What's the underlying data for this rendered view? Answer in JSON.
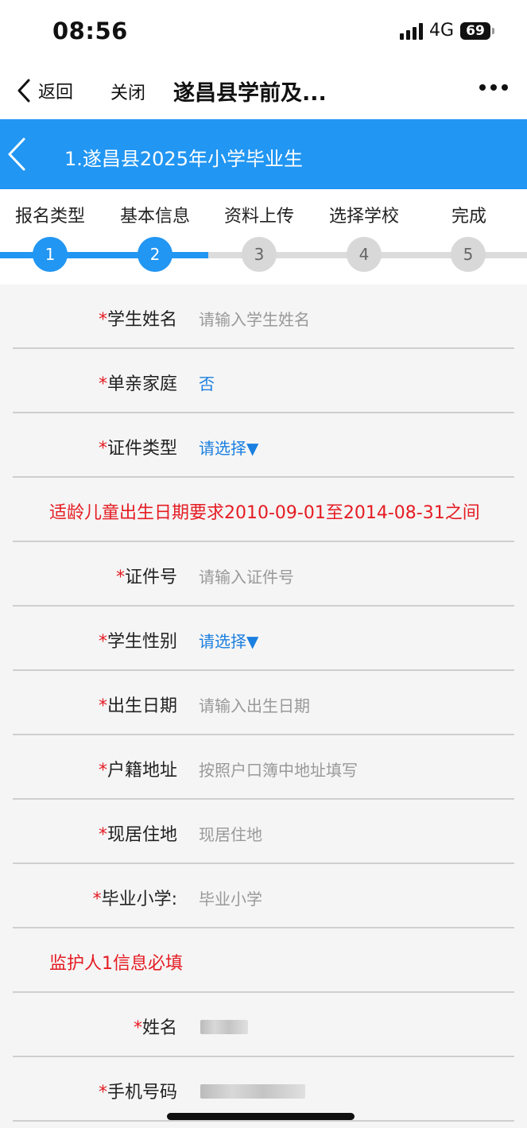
{
  "status": {
    "time": "08:56",
    "network": "4G",
    "battery": "69"
  },
  "nav": {
    "back_label": "返回",
    "close_label": "关闭",
    "title": "遂昌县学前及..."
  },
  "header": {
    "title": "1.遂昌县2025年小学毕业生"
  },
  "steps": [
    {
      "label": "报名类型",
      "number": "1",
      "state": "done"
    },
    {
      "label": "基本信息",
      "number": "2",
      "state": "current"
    },
    {
      "label": "资料上传",
      "number": "3",
      "state": "pending"
    },
    {
      "label": "选择学校",
      "number": "4",
      "state": "pending"
    },
    {
      "label": "完成",
      "number": "5",
      "state": "pending"
    }
  ],
  "form": {
    "student_name": {
      "label": "学生姓名",
      "placeholder": "请输入学生姓名"
    },
    "single_parent": {
      "label": "单亲家庭",
      "value": "否"
    },
    "id_type": {
      "label": "证件类型",
      "value": "请选择▼"
    },
    "age_notice": "适龄儿童出生日期要求2010-09-01至2014-08-31之间",
    "id_number": {
      "label": "证件号",
      "placeholder": "请输入证件号"
    },
    "gender": {
      "label": "学生性别",
      "value": "请选择▼"
    },
    "birth_date": {
      "label": "出生日期",
      "placeholder": "请输入出生日期"
    },
    "household_address": {
      "label": "户籍地址",
      "placeholder": "按照户口簿中地址填写"
    },
    "current_address": {
      "label": "现居住地",
      "placeholder": "现居住地"
    },
    "primary_school": {
      "label": "毕业小学:",
      "placeholder": "毕业小学"
    },
    "guardian_notice": "监护人1信息必填",
    "guardian_name": {
      "label": "姓名"
    },
    "guardian_phone": {
      "label": "手机号码"
    }
  },
  "required_mark": "*",
  "colors": {
    "primary": "#2196f3",
    "required": "#e51c23",
    "select": "#1a7fe0"
  }
}
